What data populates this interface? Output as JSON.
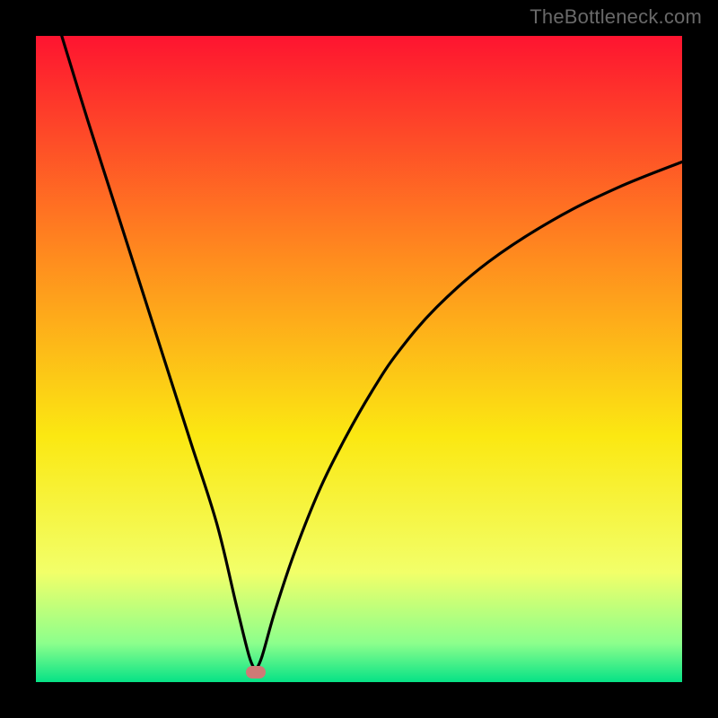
{
  "watermark": "TheBottleneck.com",
  "gradient": {
    "top": "#fe1430",
    "upper_mid": "#ff8e1e",
    "mid": "#fbe812",
    "lower_mid": "#f2ff69",
    "near_bottom": "#8cff8c",
    "bottom": "#06e286"
  },
  "chart_data": {
    "type": "line",
    "title": "",
    "xlabel": "",
    "ylabel": "",
    "xlim": [
      0,
      100
    ],
    "ylim": [
      0,
      100
    ],
    "y_orientation": "inverted_visual",
    "series": [
      {
        "name": "bottleneck-curve",
        "note": "V-shaped curve; y is visual height from bottom (0=bottom, 100=top). Minimum near x≈34.",
        "x": [
          4,
          8,
          12,
          16,
          20,
          24,
          28,
          31,
          33,
          34,
          35,
          37,
          40,
          44,
          48,
          52,
          56,
          62,
          70,
          80,
          90,
          100
        ],
        "y": [
          100,
          87,
          74.5,
          62,
          49.5,
          37,
          24.5,
          12,
          4,
          1.8,
          4,
          11,
          20,
          30,
          38,
          45,
          51,
          58,
          65,
          71.5,
          76.5,
          80.5
        ]
      }
    ],
    "marker": {
      "name": "optimal-point",
      "x": 34,
      "y": 1.5,
      "color": "#cf7a76",
      "shape": "pill"
    }
  }
}
